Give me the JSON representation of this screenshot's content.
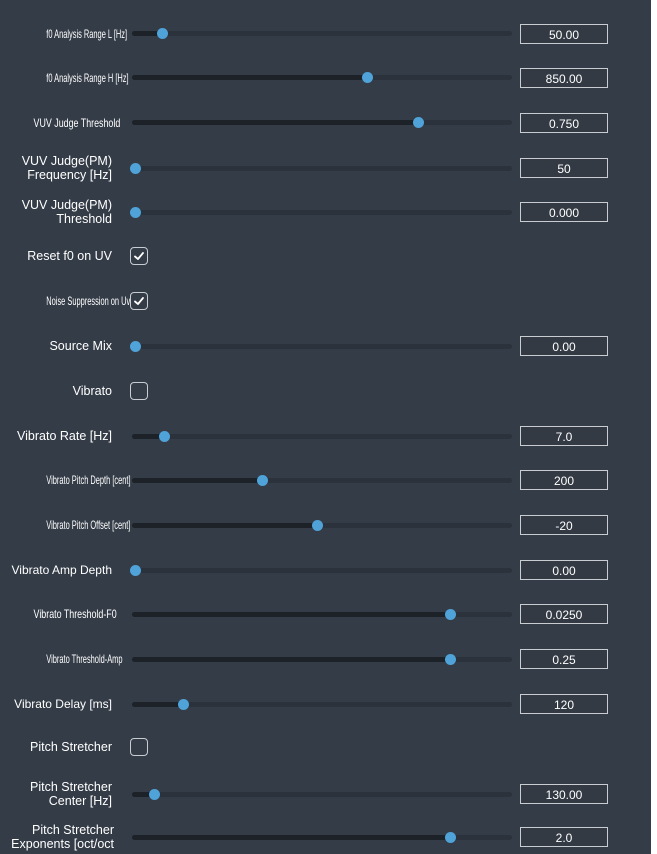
{
  "params": {
    "f0_range_l": {
      "label": "f0 Analysis Range L [Hz]",
      "value": "50.00",
      "level": 0.07
    },
    "f0_range_h": {
      "label": "f0 Analysis Range H [Hz]",
      "value": "850.00",
      "level": 0.61
    },
    "vuv_threshold": {
      "label": "VUV Judge Threshold",
      "value": "0.750",
      "level": 0.745
    },
    "vuv_pm_freq": {
      "label": "VUV Judge(PM) Frequency [Hz]",
      "value": "50",
      "level": 0.0
    },
    "vuv_pm_threshold": {
      "label": "VUV Judge(PM) Threshold",
      "value": "0.000",
      "level": 0.0
    },
    "reset_f0_uv": {
      "label": "Reset f0 on UV",
      "checked": true
    },
    "noise_supp_uv": {
      "label": "Noise Suppression on Uv",
      "checked": true
    },
    "source_mix": {
      "label": "Source Mix",
      "value": "0.00",
      "level": 0.0
    },
    "vibrato": {
      "label": "Vibrato",
      "checked": false
    },
    "vibrato_rate": {
      "label": "Vibrato Rate [Hz]",
      "value": "7.0",
      "level": 0.075
    },
    "vib_pitch_depth": {
      "label": "Vibrato Pitch Depth [cent]",
      "value": "200",
      "level": 0.335
    },
    "vib_pitch_offset": {
      "label": "Vibrato Pitch Offset [cent]",
      "value": "-20",
      "level": 0.48
    },
    "vib_amp_depth": {
      "label": "Vibrato Amp Depth",
      "value": "0.00",
      "level": 0.0
    },
    "vib_thr_f0": {
      "label": "Vibrato Threshold-F0",
      "value": "0.0250",
      "level": 0.83
    },
    "vib_thr_amp": {
      "label": "Vibrato Threshold-Amp",
      "value": "0.25",
      "level": 0.83
    },
    "vib_delay": {
      "label": "Vibrato Delay [ms]",
      "value": "120",
      "level": 0.125
    },
    "pitch_stretcher": {
      "label": "Pitch Stretcher",
      "checked": false
    },
    "ps_center": {
      "label": "Pitch Stretcher Center [Hz]",
      "value": "130.00",
      "level": 0.05
    },
    "ps_exponents": {
      "label": "Pitch Stretcher Exponents [oct/oct",
      "value": "2.0",
      "level": 0.83
    }
  },
  "colors": {
    "panel": "#343c47",
    "track": "#2b323b",
    "fill": "#1d2228",
    "thumb": "#4fa3d9",
    "text": "#ffffff"
  },
  "icons": {
    "checkmark": "checkmark-icon"
  }
}
